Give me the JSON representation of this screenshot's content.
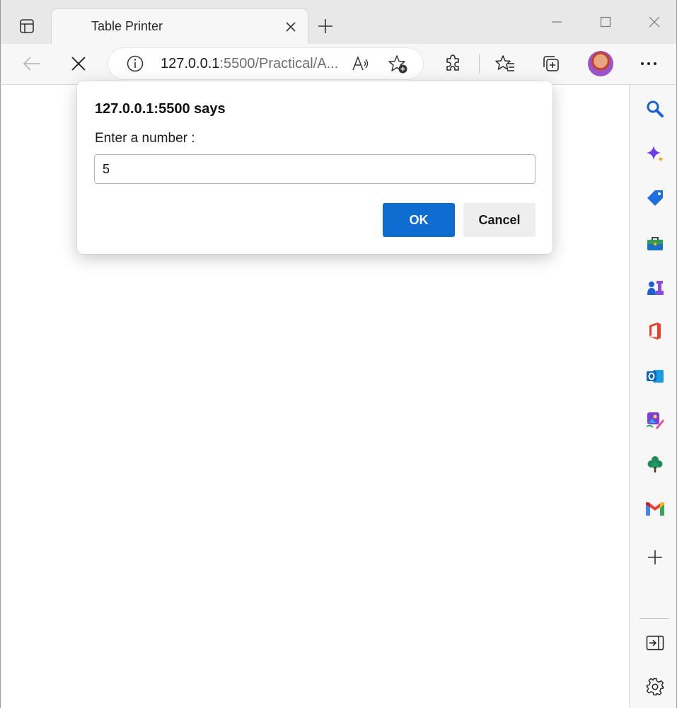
{
  "browser": {
    "tab": {
      "title": "Table Printer"
    },
    "address": {
      "host": "127.0.0.1",
      "rest": ":5500/Practical/A..."
    }
  },
  "dialog": {
    "title": "127.0.0.1:5500 says",
    "message": "Enter a number :",
    "input_value": "5",
    "ok_label": "OK",
    "cancel_label": "Cancel"
  },
  "colors": {
    "accent": "#0f6cd1",
    "toolbar_bg": "#f7f7f7",
    "tabstrip_bg": "#e8e8e8"
  },
  "icons": {
    "toolbar": [
      "back-arrow-icon",
      "stop-icon",
      "info-icon",
      "read-aloud-icon",
      "add-favorite-icon",
      "extensions-icon",
      "favorites-icon",
      "collections-icon",
      "profile-avatar",
      "more-icon"
    ],
    "sidebar": [
      "search-icon",
      "copilot-icon",
      "shopping-icon",
      "tools-icon",
      "games-icon",
      "office-icon",
      "outlook-icon",
      "designer-icon",
      "tree-icon",
      "gmail-icon",
      "add-icon",
      "hide-sidebar-icon",
      "settings-icon"
    ]
  }
}
